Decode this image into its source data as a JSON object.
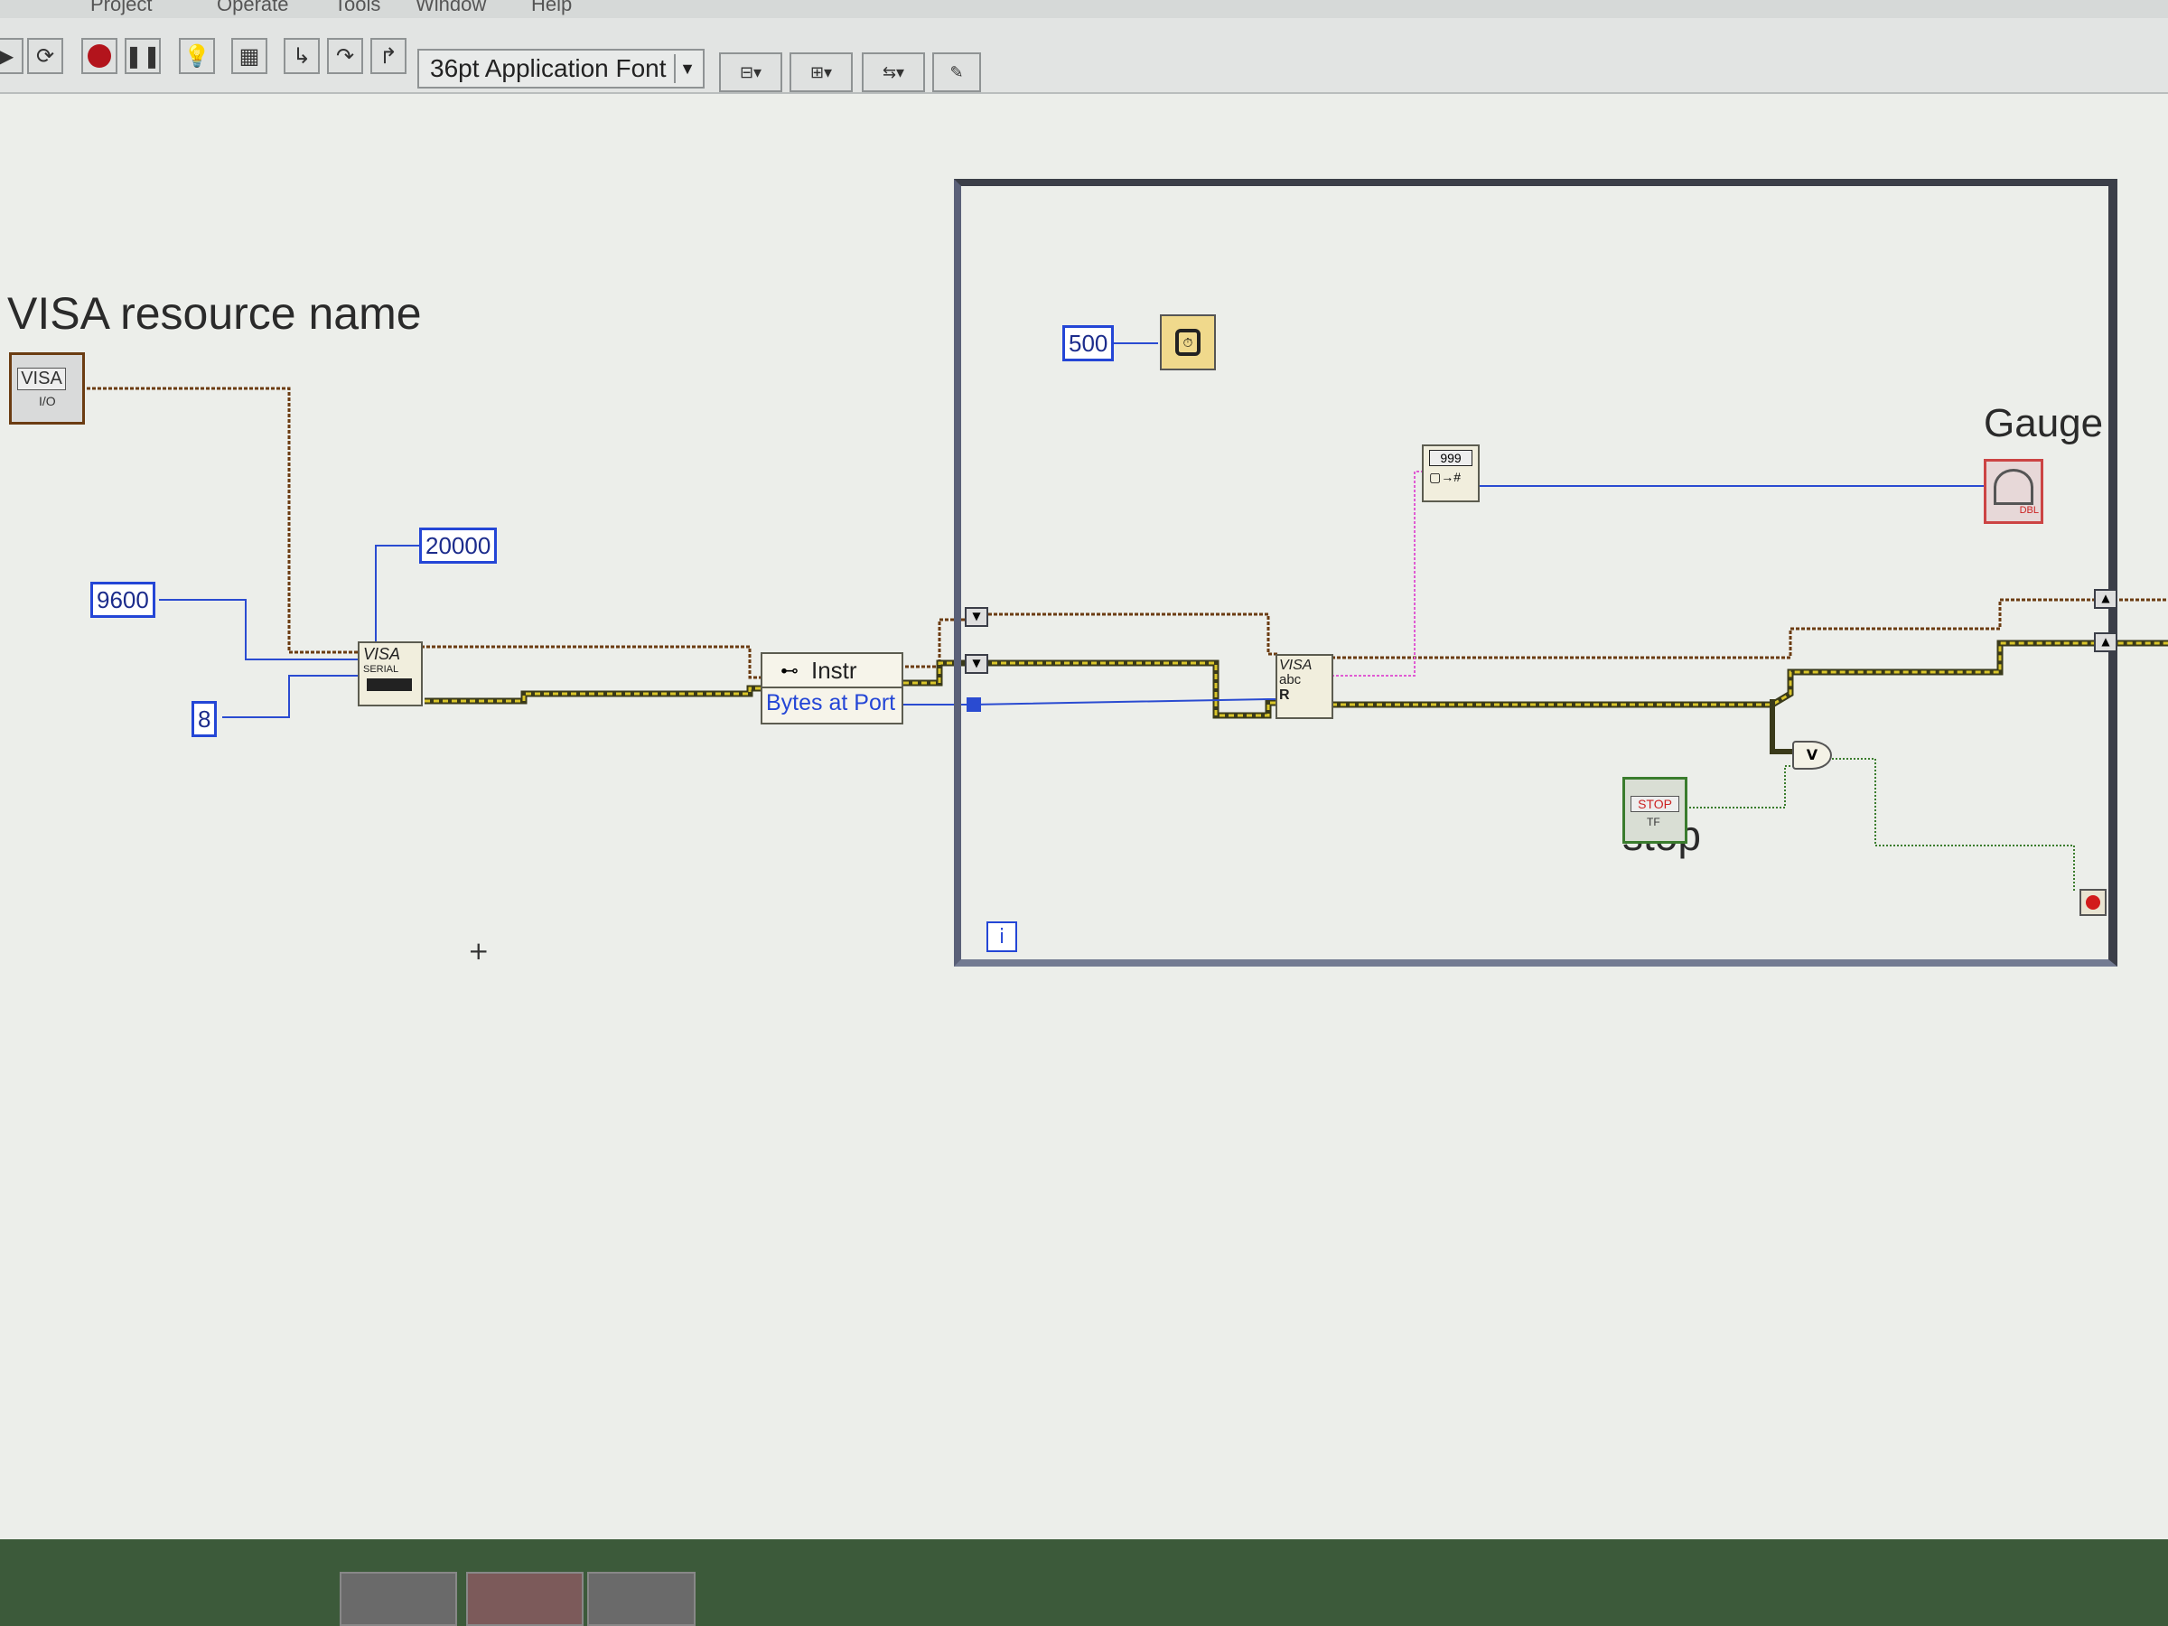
{
  "menubar": {
    "items": [
      "Project",
      "Operate",
      "Tools",
      "Window",
      "Help"
    ]
  },
  "toolbar": {
    "buttons": [
      {
        "name": "run-arrow-icon"
      },
      {
        "name": "run-continuously-icon"
      },
      {
        "name": "abort-icon"
      },
      {
        "name": "pause-icon"
      },
      {
        "name": "highlight-execution-icon"
      },
      {
        "name": "retain-wire-values-icon"
      },
      {
        "name": "step-into-icon"
      },
      {
        "name": "step-over-icon"
      },
      {
        "name": "step-out-icon"
      }
    ],
    "font_select": "36pt Application Font",
    "dropdowns": [
      "align-objects-icon",
      "distribute-objects-icon",
      "reorder-icon",
      "clean-up-diagram-icon"
    ]
  },
  "diagram": {
    "visa_label": "VISA resource name",
    "visa_control_text": "VISA",
    "visa_control_sub": "I/O",
    "const_baud": "9600",
    "const_databits": "8",
    "const_timeout": "20000",
    "serial_node_title": "VISA",
    "serial_node_sub": "SERIAL",
    "property_node_class": "Instr",
    "property_node_prop": "Bytes at Port",
    "wait_const": "500",
    "read_node_title": "VISA",
    "read_node_sub": "abc",
    "read_node_r": "R",
    "numeric_node_text": "999",
    "gauge_label": "Gauge",
    "gauge_sub": "DBL",
    "stop_label": "stop",
    "stop_button_text": "STOP",
    "stop_tf": "TF",
    "or_symbol": "V",
    "loop_iteration": "i"
  },
  "colors": {
    "wire_visa": "#6b3c12",
    "wire_error": "#c2b41a",
    "wire_number": "#2a4bd1",
    "wire_string": "#e05bd3",
    "wire_bool": "#3a7c2d",
    "loop_border": "#3b3e48",
    "background": "#eceeea"
  }
}
